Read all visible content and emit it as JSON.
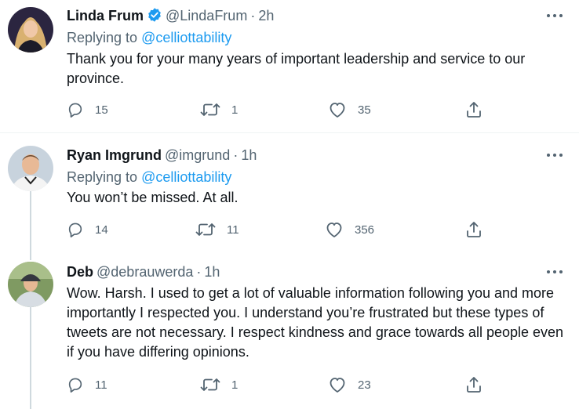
{
  "tweets": [
    {
      "display_name": "Linda Frum",
      "verified": true,
      "handle": "@LindaFrum",
      "separator": "·",
      "time": "2h",
      "replying_prefix": "Replying to ",
      "replying_to": "@celliottability",
      "text": "Thank you for your many years of important leadership and service to our province.",
      "replies": "15",
      "retweets": "1",
      "likes": "35"
    },
    {
      "display_name": "Ryan Imgrund",
      "verified": false,
      "handle": "@imgrund",
      "separator": "·",
      "time": "1h",
      "replying_prefix": "Replying to ",
      "replying_to": "@celliottability",
      "text": "You won’t be missed. At all.",
      "replies": "14",
      "retweets": "11",
      "likes": "356"
    },
    {
      "display_name": "Deb",
      "verified": false,
      "handle": "@debrauwerda",
      "separator": "·",
      "time": "1h",
      "text": "Wow. Harsh. I used to get a lot of valuable information following you and more importantly I respected you. I understand you’re frustrated but these types of tweets are not necessary. I respect kindness and grace towards all people even if you have differing opinions.",
      "replies": "11",
      "retweets": "1",
      "likes": "23"
    }
  ],
  "icons": {
    "more": "more-horizontal",
    "reply": "reply-bubble",
    "retweet": "retweet-arrows",
    "like": "heart-outline",
    "share": "share-upload",
    "verified": "verified-badge"
  },
  "colors": {
    "text": "#0f1419",
    "secondary": "#536471",
    "accent": "#1d9bf0",
    "divider": "#eff3f4",
    "thread": "#cfd9de"
  }
}
